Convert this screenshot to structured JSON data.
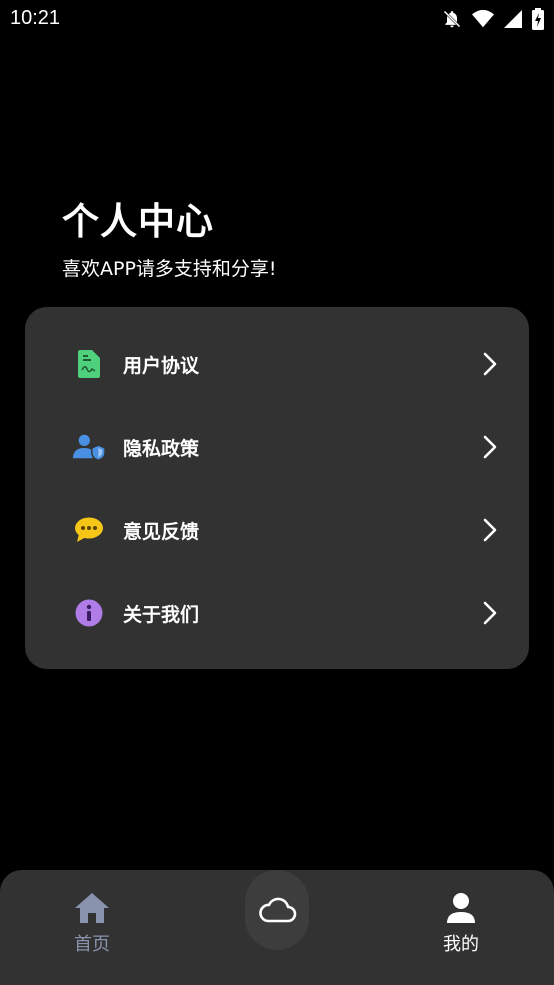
{
  "status_bar": {
    "time": "10:21"
  },
  "header": {
    "title": "个人中心",
    "subtitle": "喜欢APP请多支持和分享!"
  },
  "menu": {
    "items": [
      {
        "label": "用户协议",
        "icon": "document-icon",
        "icon_color": "#4ed07c"
      },
      {
        "label": "隐私政策",
        "icon": "user-shield-icon",
        "icon_color": "#4a90e2"
      },
      {
        "label": "意见反馈",
        "icon": "chat-bubble-icon",
        "icon_color": "#f5c518"
      },
      {
        "label": "关于我们",
        "icon": "info-icon",
        "icon_color": "#b07de8"
      }
    ]
  },
  "bottom_nav": {
    "items": [
      {
        "label": "首页",
        "icon": "home-icon",
        "active": false,
        "color": "#8a93ad"
      },
      {
        "label": "",
        "icon": "cloud-icon",
        "active": false
      },
      {
        "label": "我的",
        "icon": "person-icon",
        "active": true,
        "color": "#ffffff"
      }
    ]
  },
  "colors": {
    "background": "#000000",
    "card": "#323232",
    "text": "#ffffff",
    "inactive_nav": "#8a93ad"
  }
}
